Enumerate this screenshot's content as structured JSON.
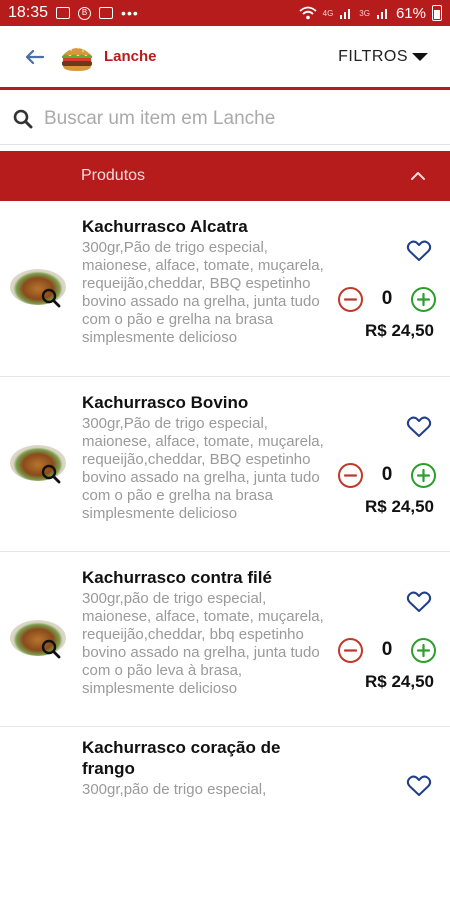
{
  "status_bar": {
    "time": "18:35",
    "signal_labels": [
      "4G",
      "3G"
    ],
    "battery": "61%"
  },
  "header": {
    "title": "Lanche",
    "filters_label": "FILTROS"
  },
  "search": {
    "placeholder": "Buscar um item em Lanche"
  },
  "section": {
    "title": "Produtos"
  },
  "products": [
    {
      "name": "Kachurrasco Alcatra",
      "description": "300gr,Pão de trigo especial, maionese, alface, tomate, muçarela, requeijão,cheddar, BBQ espetinho bovino assado na grelha, junta tudo com o pão e grelha na brasa simplesmente delicioso",
      "quantity": "0",
      "price": "R$ 24,50"
    },
    {
      "name": "Kachurrasco Bovino",
      "description": "300gr,Pão de trigo especial, maionese, alface, tomate, muçarela, requeijão,cheddar, BBQ espetinho bovino assado na grelha, junta tudo com o pão e grelha na brasa simplesmente delicioso",
      "quantity": "0",
      "price": "R$ 24,50"
    },
    {
      "name": "Kachurrasco contra filé",
      "description": "300gr,pão de trigo especial, maionese, alface, tomate, muçarela, requeijão,cheddar, bbq espetinho bovino assado na grelha, junta tudo com o pão leva à brasa, simplesmente delicioso",
      "quantity": "0",
      "price": "R$ 24,50"
    },
    {
      "name": "Kachurrasco coração de frango",
      "description": "300gr,pão de trigo especial,"
    }
  ],
  "colors": {
    "brand_red": "#b71c1c",
    "minus": "#c0392b",
    "plus": "#2e9d2e",
    "heart": "#1f3f8a"
  },
  "icons": [
    "back-arrow-icon",
    "burger-icon",
    "caret-down-icon",
    "search-icon",
    "chevron-up-icon",
    "zoom-icon",
    "heart-icon",
    "minus-circle-icon",
    "plus-circle-icon"
  ]
}
